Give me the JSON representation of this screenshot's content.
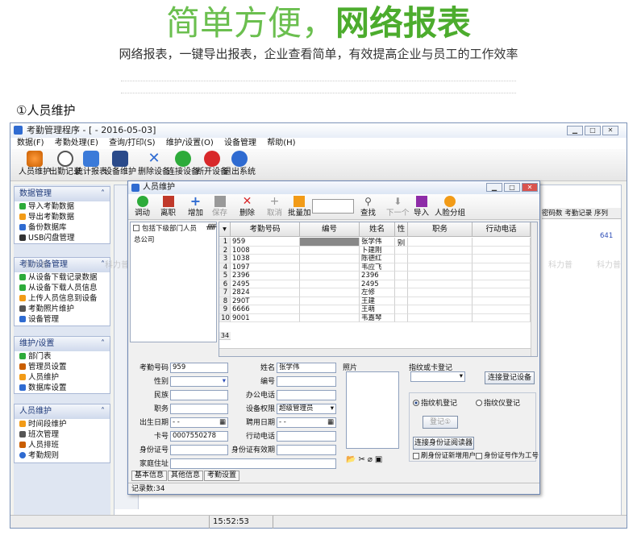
{
  "headline": {
    "part1": "简单方便，",
    "part2": "网络报表"
  },
  "subtitle": "网络报表，一键导出报表，企业查看简单，有效提高企业与员工的工作效率",
  "section_title": "①人员维护",
  "main_window": {
    "title": "考勤管理程序 - [ - 2016-05-03]",
    "menu": [
      "数据(F)",
      "考勤处理(E)",
      "查询/打印(S)",
      "维护/设置(O)",
      "设备管理",
      "帮助(H)"
    ],
    "toolbar": [
      "人员维护",
      "出勤记录",
      "统计报表",
      "设备维护",
      "删除设备",
      "连接设备",
      "断开设备",
      "退出系统"
    ],
    "status_time": "15:52:53",
    "right_cols": [
      "密码数",
      "考勤记录",
      "序列"
    ],
    "right_value": "641"
  },
  "left_panel": {
    "groups": [
      {
        "title": "数据管理",
        "items": [
          "导入考勤数据",
          "导出考勤数据",
          "备份数据库",
          "USB闪盘管理"
        ]
      },
      {
        "title": "考勤设备管理",
        "items": [
          "从设备下载记录数据",
          "从设备下载人员信息",
          "上传人员信息到设备",
          "考勤照片维护",
          "设备管理"
        ]
      },
      {
        "title": "维护/设置",
        "items": [
          "部门表",
          "管理员设置",
          "人员维护",
          "数据库设置"
        ]
      },
      {
        "title": "人员维护",
        "items": [
          "时间段维护",
          "班次管理",
          "人员排班",
          "考勤规则"
        ]
      }
    ]
  },
  "dialog": {
    "title": "人员维护",
    "toolbar": [
      "调动",
      "离职",
      "增加",
      "保存",
      "删除",
      "取消",
      "批量加",
      "查找",
      "下一个",
      "导入",
      "人脸分组"
    ],
    "dept_checkbox": "包括下级部门人员",
    "dept_root": "总公司",
    "columns": [
      "考勤号码",
      "编号",
      "姓名",
      "性别",
      "职务",
      "行动电话"
    ],
    "rows": [
      {
        "n": "1",
        "id": "959",
        "name": "张学伟"
      },
      {
        "n": "2",
        "id": "1008",
        "name": "卜建刚"
      },
      {
        "n": "3",
        "id": "1038",
        "name": "陈德红"
      },
      {
        "n": "4",
        "id": "1097",
        "name": "韦应飞"
      },
      {
        "n": "5",
        "id": "2396",
        "name": "2396"
      },
      {
        "n": "6",
        "id": "2495",
        "name": "2495"
      },
      {
        "n": "7",
        "id": "2824",
        "name": "左修"
      },
      {
        "n": "8",
        "id": "290T",
        "name": "王建"
      },
      {
        "n": "9",
        "id": "6666",
        "name": "王萌"
      },
      {
        "n": "10",
        "id": "9001",
        "name": "韦嘉琴"
      }
    ],
    "row_count_marker": "34",
    "form": {
      "labels": [
        "考勤号码",
        "性别",
        "民族",
        "职务",
        "出生日期",
        "卡号",
        "身份证号",
        "家庭住址",
        "姓名",
        "编号",
        "办公电话",
        "设备权限",
        "聘用日期",
        "行动电话",
        "身份证有效期"
      ],
      "att_no": "959",
      "name": "张学伟",
      "card_no": "0007550278",
      "device_perm": "超级管理员",
      "date_placeholder": "- -",
      "photo_label": "照片",
      "fp_label": "指纹或卡登记",
      "fp_connect": "连接登记设备",
      "radio_fp": "指纹机登记",
      "radio_dev": "指纹仪登记",
      "register_btn": "登记①",
      "id_reader_btn": "连接身份证阅读器",
      "chk_id_user": "刷身份证新增用户",
      "chk_id_as_no": "身份证号作为工号"
    },
    "tabs": [
      "基本信息",
      "其他信息",
      "考勤设置"
    ],
    "status": "记录数:34"
  },
  "watermark": "科力普",
  "colors": {
    "brand_green": "#4cac2d",
    "header_blue": "#1f3a7a"
  }
}
